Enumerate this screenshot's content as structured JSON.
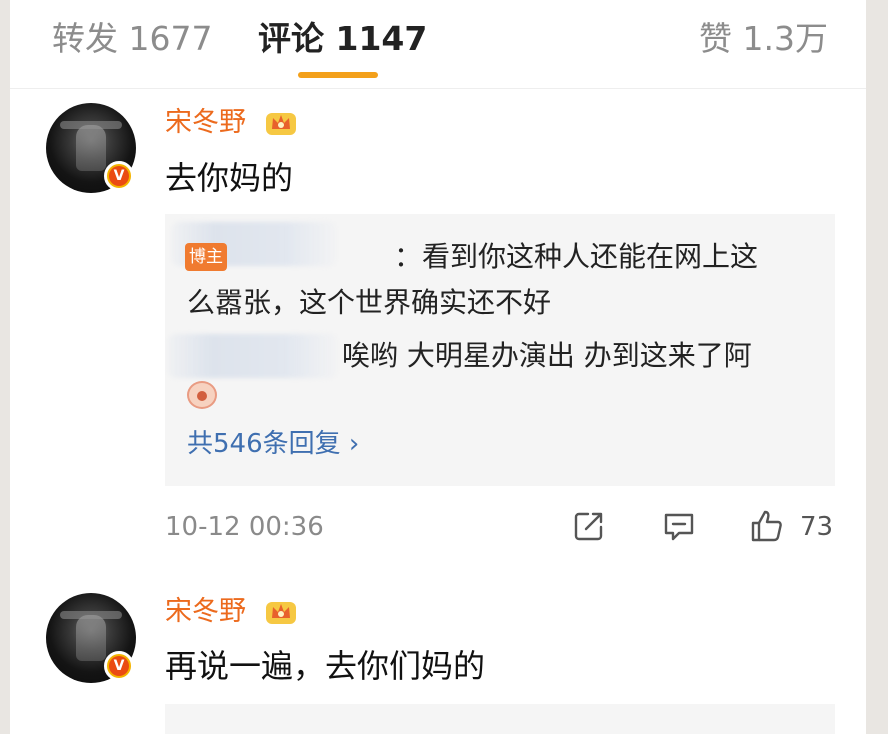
{
  "tabs": {
    "repost": "转发 1677",
    "comments": "评论 1147",
    "likes": "赞 1.3万"
  },
  "comments": [
    {
      "username": "宋冬野",
      "text": "去你妈的",
      "avatar_badge": "V",
      "replies": {
        "author_badge": "博主",
        "reply1_line1": "：看到你这种人还能在网上这",
        "reply1_line2": "么嚣张，这个世界确实还不好",
        "reply2_line1": "唉哟 大明星办演出 办到这来了阿",
        "more": "共546条回复 ›"
      },
      "timestamp": "10-12 00:36",
      "likes": "73"
    },
    {
      "username": "宋冬野",
      "text": "再说一遍，去你们妈的",
      "avatar_badge": "V"
    }
  ],
  "icons": {
    "repost": "share-icon",
    "comment": "comment-icon",
    "like": "thumbs-up-icon",
    "crown": "crown-badge-icon"
  },
  "colors": {
    "accent": "#f3a01a",
    "username": "#ec6a1d",
    "link": "#3f6fb0",
    "author_badge": "#f07b30",
    "verified": "#ea4b12"
  }
}
